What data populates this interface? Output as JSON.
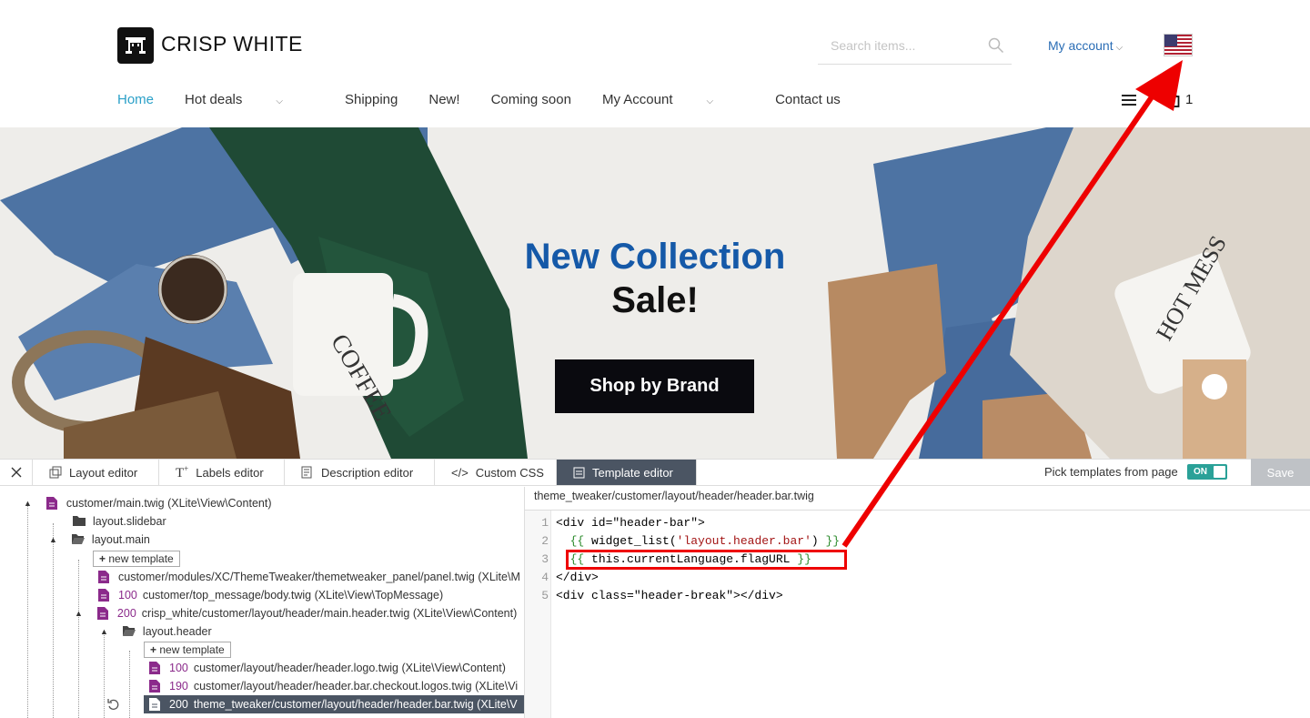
{
  "header": {
    "brand": "CRISP WHITE",
    "search_placeholder": "Search items...",
    "account_label": "My account",
    "cart_count": "1"
  },
  "nav": {
    "items": [
      "Home",
      "Hot deals",
      "Shipping",
      "New!",
      "Coming soon",
      "My Account",
      "Contact us"
    ]
  },
  "hero": {
    "title": "New Collection",
    "subtitle": "Sale!",
    "button": "Shop by Brand"
  },
  "tweaker": {
    "tabs": [
      "Layout editor",
      "Labels editor",
      "Description editor",
      "Custom CSS",
      "Template editor"
    ],
    "pick_label": "Pick templates from page",
    "toggle": "ON",
    "save": "Save"
  },
  "tree": {
    "root": "customer/main.twig (XLite\\View\\Content)",
    "slidebar": "layout.slidebar",
    "main": "layout.main",
    "new_template": "new template",
    "panel": "customer/modules/XC/ThemeTweaker/themetweaker_panel/panel.twig (XLite\\M",
    "top_msg_num": "100",
    "top_msg": "customer/top_message/body.twig (XLite\\View\\TopMessage)",
    "main_header_num": "200",
    "main_header": "crisp_white/customer/layout/header/main.header.twig (XLite\\View\\Content)",
    "layout_header": "layout.header",
    "logo_num": "100",
    "logo": "customer/layout/header/header.logo.twig (XLite\\View\\Content)",
    "checkout_num": "190",
    "checkout": "customer/layout/header/header.bar.checkout.logos.twig (XLite\\Vi",
    "bar_num": "200",
    "bar": "theme_tweaker/customer/layout/header/header.bar.twig (XLite\\V"
  },
  "editor": {
    "path": "theme_tweaker/customer/layout/header/header.bar.twig",
    "line_numbers": [
      "1",
      "2",
      "3",
      "4",
      "5"
    ]
  },
  "colors": {
    "accent": "#2ba0c8",
    "brand_blue": "#1559a8",
    "annotation_red": "#e00000",
    "toggle_on": "#2aa198"
  }
}
